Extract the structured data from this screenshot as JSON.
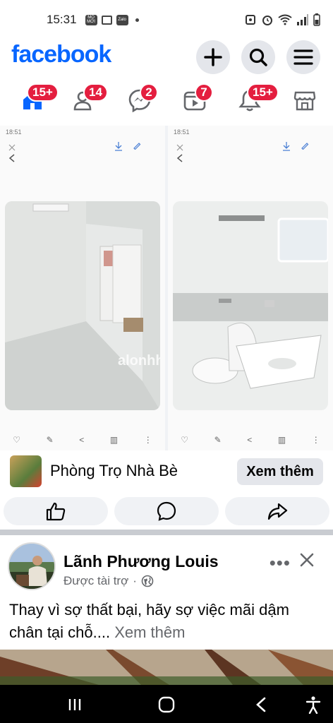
{
  "status": {
    "time": "15:31",
    "mini_icons": [
      "MO MỚI",
      "Zalo"
    ]
  },
  "header": {
    "logo": "facebook",
    "buttons": [
      "plus-icon",
      "search-icon",
      "menu-icon"
    ]
  },
  "nav": {
    "items": [
      {
        "name": "home",
        "badge": "15+"
      },
      {
        "name": "friends",
        "badge": "14"
      },
      {
        "name": "messenger",
        "badge": "2"
      },
      {
        "name": "video",
        "badge": "7"
      },
      {
        "name": "notifications",
        "badge": "15+"
      },
      {
        "name": "marketplace",
        "badge": ""
      }
    ]
  },
  "post_media": {
    "screenshot_time_left": "18:51",
    "screenshot_time_right": "18:51",
    "watermark": "alonhha",
    "room_photos": [
      "room-interior",
      "bathroom"
    ]
  },
  "page_row": {
    "page_name": "Phòng Trọ Nhà Bè",
    "see_more_button": "Xem thêm"
  },
  "action_row": {
    "actions": [
      "like-icon",
      "comment-icon",
      "share-icon"
    ]
  },
  "post2": {
    "author": "Lãnh Phương Louis",
    "sponsored": "Được tài trợ",
    "separator": "·",
    "caption_text": "Thay vì sợ thất bại, hãy sợ việc mãi dậm chân tại chỗ....",
    "caption_more": " Xem thêm",
    "more_label": "•••"
  },
  "colors": {
    "brand": "#0866ff",
    "badge": "#e41e3f",
    "pill_bg": "#e4e6eb",
    "secondary_text": "#65676b"
  }
}
